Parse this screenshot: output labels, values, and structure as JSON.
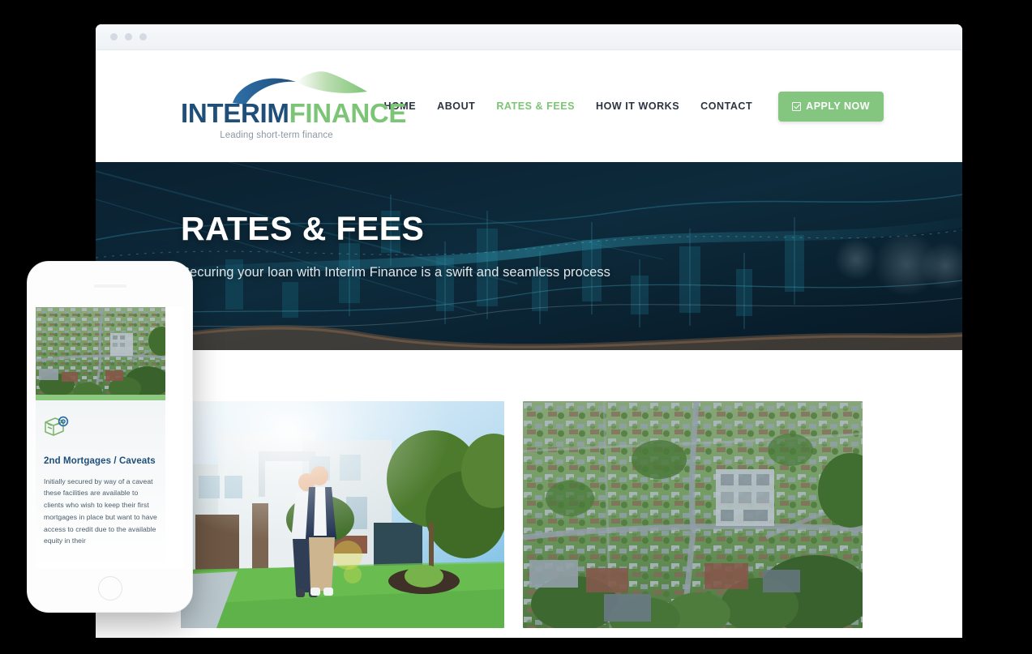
{
  "browser": {
    "window_dots": [
      "dot-1",
      "dot-2",
      "dot-3"
    ]
  },
  "header": {
    "logo": {
      "word_primary": "INTERIM",
      "word_secondary": "FINANCE",
      "tagline": "Leading short-term finance",
      "primary_color": "#1f4e79",
      "secondary_color": "#7cc576"
    },
    "nav": [
      {
        "label": "HOME",
        "active": false
      },
      {
        "label": "ABOUT",
        "active": false
      },
      {
        "label": "RATES & FEES",
        "active": true
      },
      {
        "label": "HOW IT WORKS",
        "active": false
      },
      {
        "label": "CONTACT",
        "active": false
      }
    ],
    "apply_button": {
      "label": "APPLY NOW",
      "icon": "checkbox-icon",
      "color": "#84c680"
    }
  },
  "hero": {
    "title": "RATES & FEES",
    "subtitle": "Securing your loan with Interim Finance is a swift and seamless process",
    "background": "financial-chart-candlestick-dark-navy",
    "background_color": "#0b2433"
  },
  "content": {
    "cards": [
      {
        "image_alt": "couple-in-front-of-suburban-house"
      },
      {
        "image_alt": "aerial-view-of-suburban-neighbourhood"
      }
    ]
  },
  "phone": {
    "card": {
      "image_alt": "aerial-view-of-suburban-neighbourhood",
      "accent_color": "#8bc97f",
      "icon": "document-seal-icon",
      "title": "2nd Mortgages / Caveats",
      "text": "Initially secured by way of a caveat these facilities are available to clients who wish to keep their first mortgages in place but want to have access to credit due to the available equity in their"
    }
  }
}
